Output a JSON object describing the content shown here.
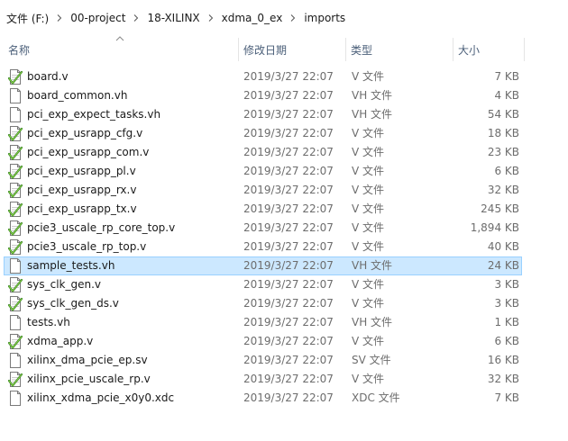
{
  "breadcrumb": [
    "文件 (F:)",
    "00-project",
    "18-XILINX",
    "xdma_0_ex",
    "imports"
  ],
  "columns": {
    "name": "名称",
    "date": "修改日期",
    "type": "类型",
    "size": "大小"
  },
  "sort": {
    "column": "name",
    "direction": "ascending",
    "icon": "sort-up-icon"
  },
  "selected_index": 10,
  "files": [
    {
      "name": "board.v",
      "date": "2019/3/27 22:07",
      "type": "V 文件",
      "size": "7 KB",
      "icon": "verilog-file-icon"
    },
    {
      "name": "board_common.vh",
      "date": "2019/3/27 22:07",
      "type": "VH 文件",
      "size": "4 KB",
      "icon": "blank-file-icon"
    },
    {
      "name": "pci_exp_expect_tasks.vh",
      "date": "2019/3/27 22:07",
      "type": "VH 文件",
      "size": "54 KB",
      "icon": "blank-file-icon"
    },
    {
      "name": "pci_exp_usrapp_cfg.v",
      "date": "2019/3/27 22:07",
      "type": "V 文件",
      "size": "18 KB",
      "icon": "verilog-file-icon"
    },
    {
      "name": "pci_exp_usrapp_com.v",
      "date": "2019/3/27 22:07",
      "type": "V 文件",
      "size": "23 KB",
      "icon": "verilog-file-icon"
    },
    {
      "name": "pci_exp_usrapp_pl.v",
      "date": "2019/3/27 22:07",
      "type": "V 文件",
      "size": "6 KB",
      "icon": "verilog-file-icon"
    },
    {
      "name": "pci_exp_usrapp_rx.v",
      "date": "2019/3/27 22:07",
      "type": "V 文件",
      "size": "32 KB",
      "icon": "verilog-file-icon"
    },
    {
      "name": "pci_exp_usrapp_tx.v",
      "date": "2019/3/27 22:07",
      "type": "V 文件",
      "size": "245 KB",
      "icon": "verilog-file-icon"
    },
    {
      "name": "pcie3_uscale_rp_core_top.v",
      "date": "2019/3/27 22:07",
      "type": "V 文件",
      "size": "1,894 KB",
      "icon": "verilog-file-icon"
    },
    {
      "name": "pcie3_uscale_rp_top.v",
      "date": "2019/3/27 22:07",
      "type": "V 文件",
      "size": "40 KB",
      "icon": "verilog-file-icon"
    },
    {
      "name": "sample_tests.vh",
      "date": "2019/3/27 22:07",
      "type": "VH 文件",
      "size": "24 KB",
      "icon": "blank-file-icon"
    },
    {
      "name": "sys_clk_gen.v",
      "date": "2019/3/27 22:07",
      "type": "V 文件",
      "size": "3 KB",
      "icon": "verilog-file-icon"
    },
    {
      "name": "sys_clk_gen_ds.v",
      "date": "2019/3/27 22:07",
      "type": "V 文件",
      "size": "3 KB",
      "icon": "verilog-file-icon"
    },
    {
      "name": "tests.vh",
      "date": "2019/3/27 22:07",
      "type": "VH 文件",
      "size": "1 KB",
      "icon": "blank-file-icon"
    },
    {
      "name": "xdma_app.v",
      "date": "2019/3/27 22:07",
      "type": "V 文件",
      "size": "6 KB",
      "icon": "verilog-file-icon"
    },
    {
      "name": "xilinx_dma_pcie_ep.sv",
      "date": "2019/3/27 22:07",
      "type": "SV 文件",
      "size": "16 KB",
      "icon": "blank-file-icon"
    },
    {
      "name": "xilinx_pcie_uscale_rp.v",
      "date": "2019/3/27 22:07",
      "type": "V 文件",
      "size": "32 KB",
      "icon": "verilog-file-icon"
    },
    {
      "name": "xilinx_xdma_pcie_x0y0.xdc",
      "date": "2019/3/27 22:07",
      "type": "XDC 文件",
      "size": "7 KB",
      "icon": "blank-file-icon"
    }
  ]
}
